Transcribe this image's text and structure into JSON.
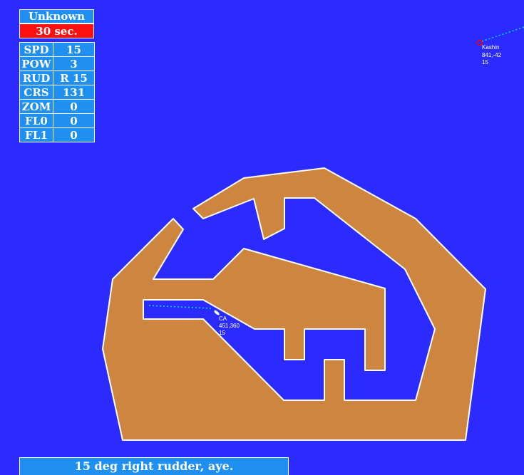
{
  "hud": {
    "ship_name": "Unknown",
    "timer": "30 sec.",
    "stats": [
      {
        "key": "SPD",
        "value": "15"
      },
      {
        "key": "POW",
        "value": "3"
      },
      {
        "key": "RUD",
        "value": "R 15"
      },
      {
        "key": "CRS",
        "value": "131"
      },
      {
        "key": "ZOM",
        "value": "0"
      },
      {
        "key": "FL0",
        "value": "0"
      },
      {
        "key": "FL1",
        "value": "0"
      }
    ]
  },
  "contacts": {
    "player": {
      "name": "CA",
      "coords": "451,360",
      "speed": "15"
    },
    "enemy": {
      "name": "Kashin",
      "coords": "841,-42",
      "speed": "15"
    }
  },
  "message": "15 deg right rudder, aye.",
  "colors": {
    "sea": "#2b2bff",
    "land": "#cd853f",
    "hud_panel": "#2090f0",
    "timer_alert": "#ff1010",
    "wake": "#00e5ff",
    "enemy_marker": "#ff0000"
  }
}
